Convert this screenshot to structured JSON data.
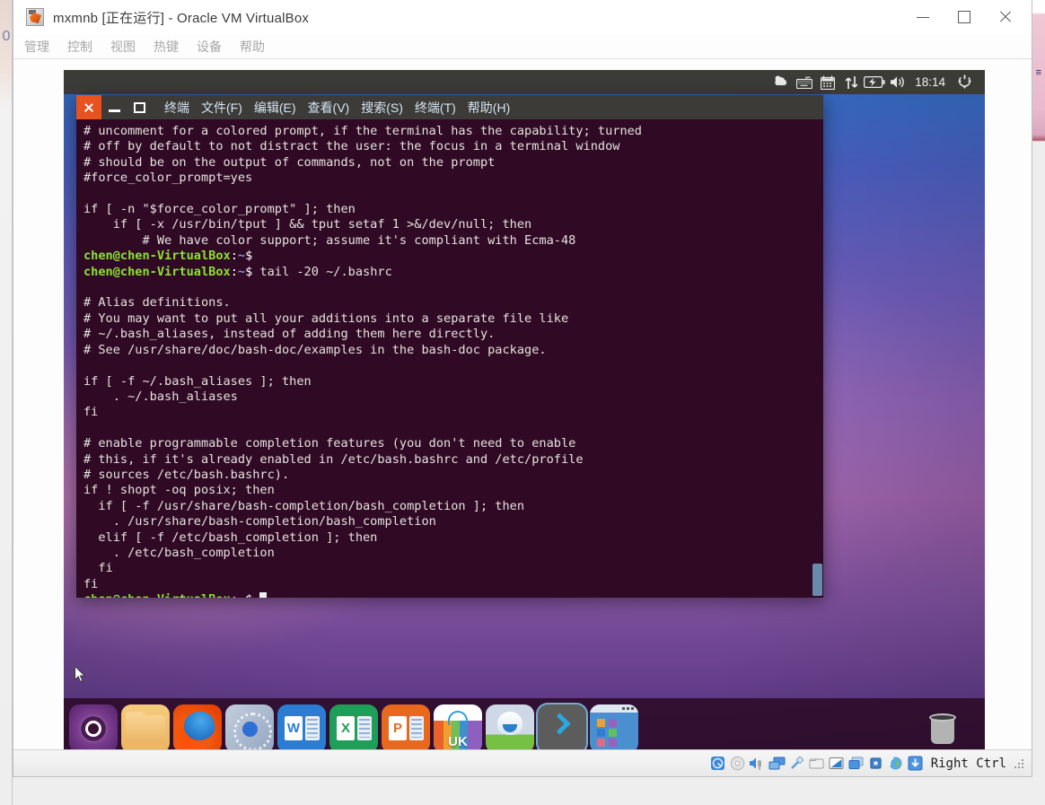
{
  "vbox": {
    "title": "mxmnb [正在运行] - Oracle VM VirtualBox",
    "app_icon": "virtualbox-icon",
    "menu": [
      {
        "label": "管理",
        "name": "menu-manage"
      },
      {
        "label": "控制",
        "name": "menu-control"
      },
      {
        "label": "视图",
        "name": "menu-view"
      },
      {
        "label": "热键",
        "name": "menu-hotkey"
      },
      {
        "label": "设备",
        "name": "menu-devices"
      },
      {
        "label": "帮助",
        "name": "menu-help"
      }
    ],
    "window_controls": {
      "minimize": "minimize-icon",
      "maximize": "maximize-icon",
      "close": "close-icon"
    },
    "statusbar": {
      "icons": [
        "hard-disk-icon",
        "optical-disk-icon",
        "audio-icon",
        "network-icon",
        "usb-icon",
        "shared-folder-icon",
        "display-icon",
        "remote-desktop-icon",
        "cpu-icon",
        "mouse-integration-icon",
        "capture-input-icon"
      ],
      "host_key": "Right Ctrl",
      "grip": "resize-grip-icon"
    }
  },
  "guest": {
    "top_panel": {
      "icons": [
        "ubuntu-one-update-icon",
        "keyboard-indicator-icon",
        "calendar-icon",
        "network-transfer-icon",
        "battery-charging-icon",
        "volume-icon"
      ],
      "clock": "18:14",
      "session_icon": "power-gear-icon"
    },
    "dock": {
      "items": [
        {
          "name": "dock-item-ubuntu-dash",
          "label": "Ubuntu Dash",
          "icon": "ubuntu-logo-icon",
          "active": false
        },
        {
          "name": "dock-item-files",
          "label": "Files",
          "icon": "folder-icon",
          "active": false
        },
        {
          "name": "dock-item-firefox",
          "label": "Firefox",
          "icon": "firefox-icon",
          "active": false
        },
        {
          "name": "dock-item-software",
          "label": "Software Updater",
          "icon": "software-updater-icon",
          "active": false
        },
        {
          "name": "dock-item-word",
          "label": "Word",
          "icon": "word-icon",
          "active": false
        },
        {
          "name": "dock-item-excel",
          "label": "Excel",
          "icon": "excel-icon",
          "active": false
        },
        {
          "name": "dock-item-powerpoint",
          "label": "PowerPoint",
          "icon": "powerpoint-icon",
          "active": false
        },
        {
          "name": "dock-item-amazon",
          "label": "Amazon UK",
          "icon": "amazon-uk-icon",
          "active": false
        },
        {
          "name": "dock-item-help",
          "label": "Ubuntu Help",
          "icon": "help-robot-icon",
          "active": false
        },
        {
          "name": "dock-item-terminal",
          "label": "Terminal",
          "icon": "terminal-chevron-icon",
          "active": true
        },
        {
          "name": "dock-item-workspaces",
          "label": "Workspace Switcher",
          "icon": "workspace-switcher-icon",
          "active": false
        }
      ],
      "trash": {
        "name": "dock-item-trash",
        "label": "Trash",
        "icon": "trash-icon"
      },
      "office_letters": {
        "word": "W",
        "excel": "X",
        "powerpoint": "P"
      },
      "amazon_label": "UK"
    },
    "terminal": {
      "window_controls": {
        "close": "close-icon",
        "minimize": "minimize-icon",
        "maximize": "maximize-icon"
      },
      "menu": [
        {
          "label": "终端",
          "name": "term-menu-terminal-app"
        },
        {
          "label": "文件(F)",
          "name": "term-menu-file"
        },
        {
          "label": "编辑(E)",
          "name": "term-menu-edit"
        },
        {
          "label": "查看(V)",
          "name": "term-menu-view"
        },
        {
          "label": "搜索(S)",
          "name": "term-menu-search"
        },
        {
          "label": "终端(T)",
          "name": "term-menu-terminal"
        },
        {
          "label": "帮助(H)",
          "name": "term-menu-help"
        }
      ],
      "prompt": {
        "user_host": "chen@chen-VirtualBox",
        "colon": ":",
        "path": "~",
        "sigil": "$"
      },
      "command": " tail -20 ~/.bashrc",
      "lines_before": [
        "# uncomment for a colored prompt, if the terminal has the capability; turned",
        "# off by default to not distract the user: the focus in a terminal window",
        "# should be on the output of commands, not on the prompt",
        "#force_color_prompt=yes",
        "",
        "if [ -n \"$force_color_prompt\" ]; then",
        "    if [ -x /usr/bin/tput ] && tput setaf 1 >&/dev/null; then",
        "        # We have color support; assume it's compliant with Ecma-48"
      ],
      "output_lines": [
        "",
        "# Alias definitions.",
        "# You may want to put all your additions into a separate file like",
        "# ~/.bash_aliases, instead of adding them here directly.",
        "# See /usr/share/doc/bash-doc/examples in the bash-doc package.",
        "",
        "if [ -f ~/.bash_aliases ]; then",
        "    . ~/.bash_aliases",
        "fi",
        "",
        "# enable programmable completion features (you don't need to enable",
        "# this, if it's already enabled in /etc/bash.bashrc and /etc/profile",
        "# sources /etc/bash.bashrc).",
        "if ! shopt -oq posix; then",
        "  if [ -f /usr/share/bash-completion/bash_completion ]; then",
        "    . /usr/share/bash-completion/bash_completion",
        "  elif [ -f /etc/bash_completion ]; then",
        "    . /etc/bash_completion",
        "  fi",
        "fi"
      ],
      "scrollbar": "vertical-scrollbar"
    },
    "cursor": "mouse-pointer"
  },
  "colors": {
    "terminal_bg": "#300a24",
    "terminal_titlebar": "#3c3b37",
    "prompt_green": "#8ae234",
    "prompt_blue": "#729fcf",
    "close_button_orange": "#e8521f",
    "panel_bg": "#3b3b37",
    "dock_bg": "#2b0a26"
  }
}
